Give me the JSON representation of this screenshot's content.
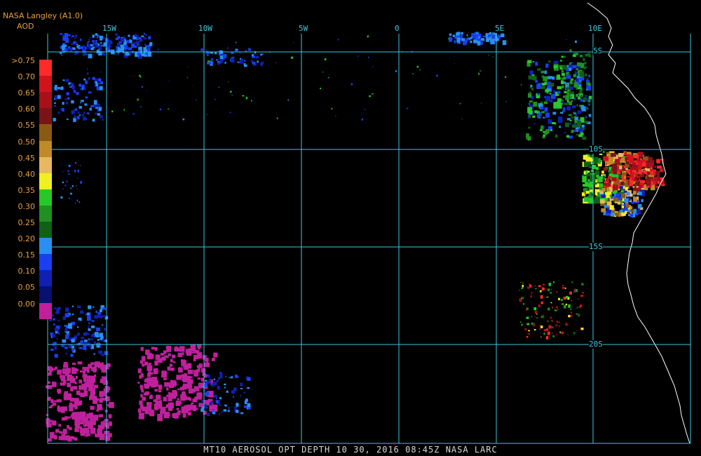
{
  "header": {
    "source": "NASA Langley (A1.0)",
    "product": "AOD"
  },
  "legend": [
    {
      "label": ">0.75",
      "color": "#ff2a2a"
    },
    {
      "label": "0.70",
      "color": "#d0141c"
    },
    {
      "label": "0.65",
      "color": "#a8101a"
    },
    {
      "label": "0.60",
      "color": "#7a1418"
    },
    {
      "label": "0.55",
      "color": "#8a5a14"
    },
    {
      "label": "0.50",
      "color": "#c08a28"
    },
    {
      "label": "0.45",
      "color": "#e8b860"
    },
    {
      "label": "0.40",
      "color": "#f0f020"
    },
    {
      "label": "0.35",
      "color": "#28c828"
    },
    {
      "label": "0.30",
      "color": "#209020"
    },
    {
      "label": "0.25",
      "color": "#106018"
    },
    {
      "label": "0.20",
      "color": "#2890f0"
    },
    {
      "label": "0.15",
      "color": "#1840f0"
    },
    {
      "label": "0.10",
      "color": "#1020b0"
    },
    {
      "label": "0.05",
      "color": "#081070"
    },
    {
      "label": "0.00",
      "color": "#c0209c"
    }
  ],
  "grid": {
    "color": "#3cc8e0",
    "lon_labels": [
      "15W",
      "10W",
      "5W",
      "0",
      "5E",
      "10E"
    ],
    "lat_labels": [
      "5S",
      "10S",
      "15S",
      "20S"
    ]
  },
  "footer": {
    "caption": "MT10  AEROSOL OPT DEPTH   10 30, 2016 08:45Z   NASA LARC"
  }
}
